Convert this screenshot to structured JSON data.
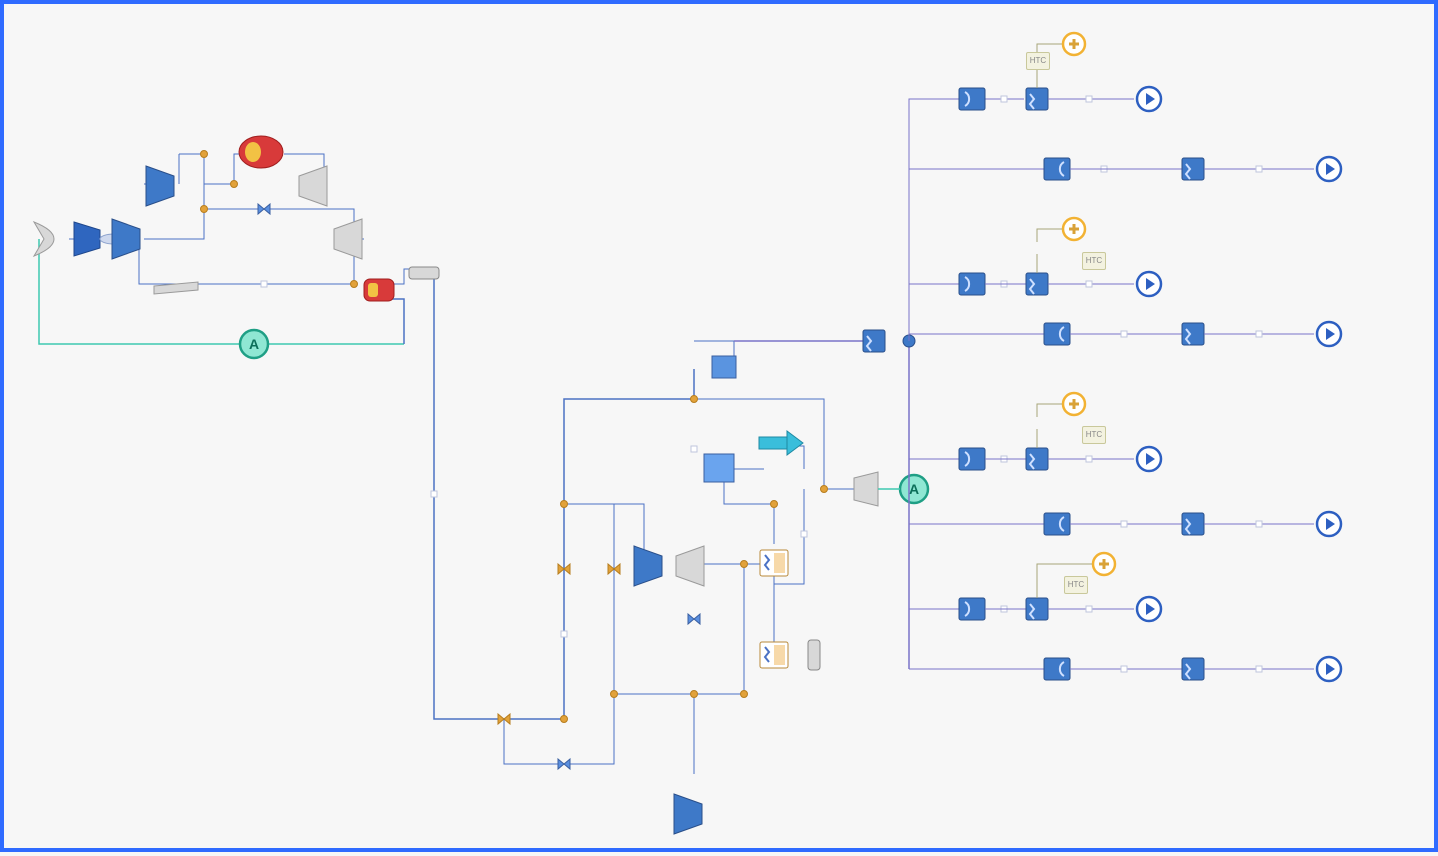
{
  "diagram": {
    "type": "process-flow-schematic",
    "htc_label": "HTC",
    "monitor_label": "A",
    "colors": {
      "pipe_main": "#4b72c4",
      "pipe_alt": "#7a73c8",
      "pipe_teal": "#3fc9b0",
      "block_blue": "#3e79c8",
      "block_dark": "#3a5fa0",
      "junction": "#e2a23a",
      "badge_ring": "#f2b233",
      "badge_ring2": "#2d5fc1",
      "monitor_ring": "#35c2a5",
      "combustor": "#d83a3a",
      "canvas": "#f7f7f7",
      "frame": "#2f6bff"
    },
    "left_cluster": {
      "components": [
        "inlet",
        "fan-compressor",
        "compressor-1",
        "compressor-2",
        "combustor-1",
        "turbine-1",
        "turbine-2",
        "combustor-2",
        "duct",
        "monitor"
      ]
    },
    "center_cluster": {
      "components": [
        "tank",
        "reservoir",
        "valve-group",
        "pump",
        "fan",
        "heat-exchanger-1",
        "heat-exchanger-2",
        "filter",
        "monitor",
        "compressor",
        "turbine",
        "outlet-fan"
      ]
    },
    "right_cluster": {
      "branches": 8,
      "branch_template": [
        "splitter",
        "hx-element",
        "boundary-badge"
      ],
      "htc_boxes": 4,
      "sensor_badges": 4
    }
  }
}
